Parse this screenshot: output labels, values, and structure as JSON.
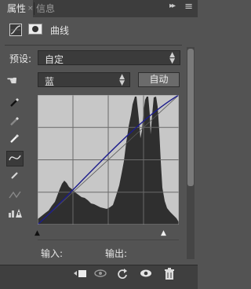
{
  "tabs": [
    {
      "label": "属性",
      "active": true
    },
    {
      "label": "信息",
      "active": false
    }
  ],
  "tab_close": "×",
  "collapse_glyph": "▸▸",
  "menu_glyph": "≡",
  "header": {
    "title": "曲线"
  },
  "preset": {
    "label": "预设:",
    "value": "自定"
  },
  "channel": {
    "value": "蓝"
  },
  "auto_button": "自动",
  "io": {
    "input_label": "输入:",
    "output_label": "输出:"
  },
  "colors": {
    "curve": "#1c1c8c",
    "histogram": "#1a1a1a",
    "graph_bg": "#c7c7c7",
    "panel": "#535353"
  },
  "icons": [
    "curves-adjustment-icon",
    "layer-mask-icon",
    "targeted-adjust-hand-icon",
    "black-point-eyedropper-icon",
    "gray-point-eyedropper-icon",
    "white-point-eyedropper-icon",
    "edit-curve-points-icon",
    "draw-pencil-icon",
    "smooth-curve-icon",
    "clipping-warning-icon",
    "clip-to-layer-icon",
    "view-previous-state-icon",
    "reset-icon",
    "visibility-eye-icon",
    "trash-icon"
  ]
}
